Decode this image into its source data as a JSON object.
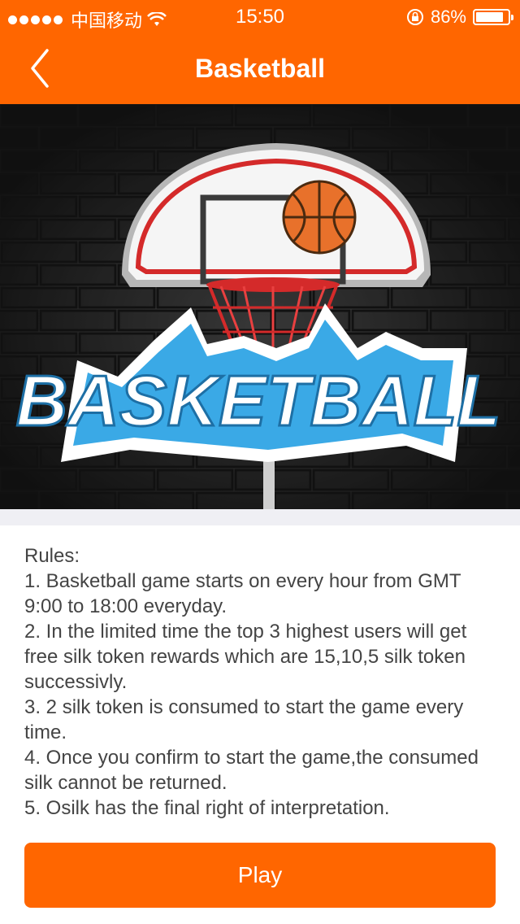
{
  "status_bar": {
    "carrier": "中国移动",
    "time": "15:50",
    "battery_percent": "86%",
    "battery_level": 0.86
  },
  "header": {
    "title": "Basketball"
  },
  "rules": {
    "heading": "Rules:",
    "items": [
      "1. Basketball game starts on every hour from GMT 9:00 to 18:00 everyday.",
      "2. In the limited time the top 3 highest users will get free silk token rewards which are 15,10,5 silk token successivly.",
      "3. 2 silk token is consumed to start the game every time.",
      "4. Once you confirm to start the game,the consumed silk cannot be returned.",
      "5. Osilk has the final right of interpretation."
    ]
  },
  "play_button": {
    "label": "Play"
  },
  "banner": {
    "logo_text": "BASKETBALL"
  },
  "colors": {
    "accent": "#ff6600",
    "logo_blue": "#3aa9e6"
  }
}
